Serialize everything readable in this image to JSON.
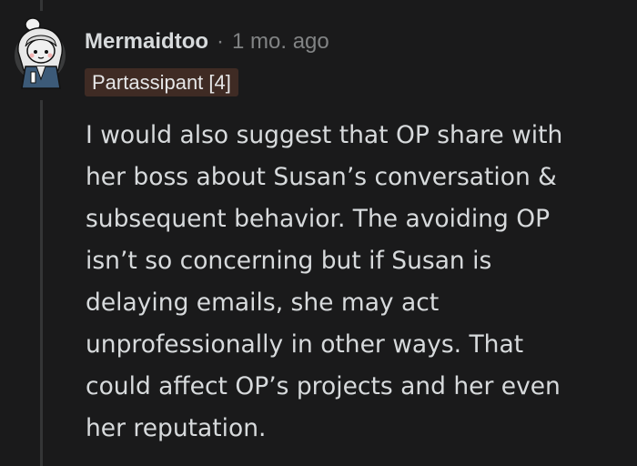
{
  "comment": {
    "author": "Mermaidtoo",
    "separator": "·",
    "timestamp": "1 mo. ago",
    "flair": "Partassipant [4]",
    "body_lines": [
      "I would also suggest that OP share with",
      "her boss about Susan’s conversation &",
      "subsequent behavior. The avoiding OP",
      "isn’t so concerning but if Susan is",
      "delaying emails, she may act",
      "unprofessionally in other ways. That",
      "could affect OP’s projects and her even",
      "her reputation."
    ]
  },
  "colors": {
    "background": "#1a1a1b",
    "thread_line": "#343536",
    "text_primary": "#d7dadc",
    "text_secondary": "#818384",
    "flair_background": "#3f2b24"
  },
  "icons": {
    "avatar": "user-avatar-icon"
  }
}
